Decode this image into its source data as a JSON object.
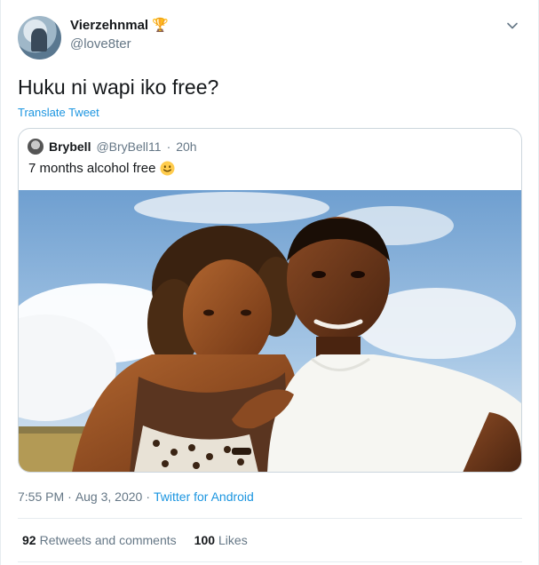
{
  "tweet": {
    "display_name": "Vierzehnmal",
    "badge_icon": "trophy-icon",
    "handle": "@love8ter",
    "text": "Huku ni wapi iko free?",
    "translate_label": "Translate Tweet",
    "menu_icon": "chevron-down-icon"
  },
  "quoted_tweet": {
    "display_name": "Brybell",
    "handle": "@BryBell11",
    "separator": "·",
    "age": "20h",
    "text": "7 months alcohol free",
    "emoji_icon": "smiley-icon",
    "photo_icon": "couple-selfie-photo"
  },
  "meta": {
    "time": "7:55 PM",
    "separator": "·",
    "date": "Aug 3, 2020",
    "separator2": "·",
    "source": "Twitter for Android"
  },
  "stats": {
    "retweets_count": "92",
    "retweets_label": "Retweets and comments",
    "likes_count": "100",
    "likes_label": "Likes"
  },
  "colors": {
    "link": "#1b95e0",
    "secondary_text": "#657786",
    "border": "#e6ecf0"
  }
}
